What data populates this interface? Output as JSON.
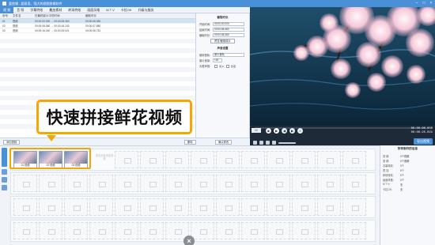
{
  "window": {
    "title": "爱剪辑 - 超易用、强大的视频剪辑软件",
    "app_name": "爱剪辑"
  },
  "menu": [
    "视 频",
    "音 频",
    "字幕特效",
    "叠加素材",
    "转场特效",
    "画面风格",
    "M T V",
    "卡拉OK",
    "升级与服务"
  ],
  "clip_table": {
    "headers": [
      "序号",
      "文件名",
      "在最终影片中的时间",
      "截取时长"
    ],
    "rows": [
      {
        "index": "01",
        "name": "视频",
        "time": "00:00:00.000 → 00:00:08.360",
        "duration": "00:00:08.360"
      },
      {
        "index": "02",
        "name": "视频",
        "time": "00:00:08.360 → 00:00:16.240",
        "duration": "00:00:07.880"
      },
      {
        "index": "03",
        "name": "视频",
        "time": "00:00:16.240 → 00:00:25.021",
        "duration": "00:00:08.781"
      }
    ]
  },
  "props_panel": {
    "trim_title": "截取时长",
    "start_label": "开始时间:",
    "start_value": "00:00:00.000",
    "end_label": "结束时间:",
    "end_value": "00:00:08.360",
    "length_label": "截取时长:",
    "length_value": "00:00:08.360",
    "preview_btn": "预览/截取原片",
    "audio_title": "声音设置",
    "track_label": "使用音轨:",
    "track_value": "原片音轨",
    "volume_label": "原片音量:",
    "volume_value": "100",
    "fade_label": "头尾声音:",
    "fade_in": "淡入",
    "fade_out": "淡出"
  },
  "toolbar": {
    "add_video": "添加视频",
    "delete": "删除",
    "confirm": "确认修改"
  },
  "playback": {
    "time_total": "00:00:00.000",
    "time_current": "00:00:25.021",
    "zoom": "1X",
    "export_label": "导出视频",
    "progress": 0
  },
  "callout": {
    "text": "快速拼接鲜花视频"
  },
  "timeline": {
    "clips": [
      "01 视频",
      "02 视频",
      "03 视频"
    ],
    "add_hint": "双击此处添加视频",
    "collapse": "×"
  },
  "side_props": {
    "title": "所有制作的信息",
    "rows": [
      {
        "k": "视 频:",
        "v": "3个视频"
      },
      {
        "k": "音 频:",
        "v": "0个音频"
      },
      {
        "k": "字幕特效:",
        "v": "0个"
      },
      {
        "k": "叠 加:",
        "v": "0个"
      },
      {
        "k": "转场特效:",
        "v": "0个"
      },
      {
        "k": "画面风格:",
        "v": "0个"
      },
      {
        "k": "M T V:",
        "v": "无"
      },
      {
        "k": "卡拉OK:",
        "v": "无"
      }
    ]
  },
  "colors": {
    "accent": "#4a90d9",
    "highlight": "#f5a700"
  }
}
